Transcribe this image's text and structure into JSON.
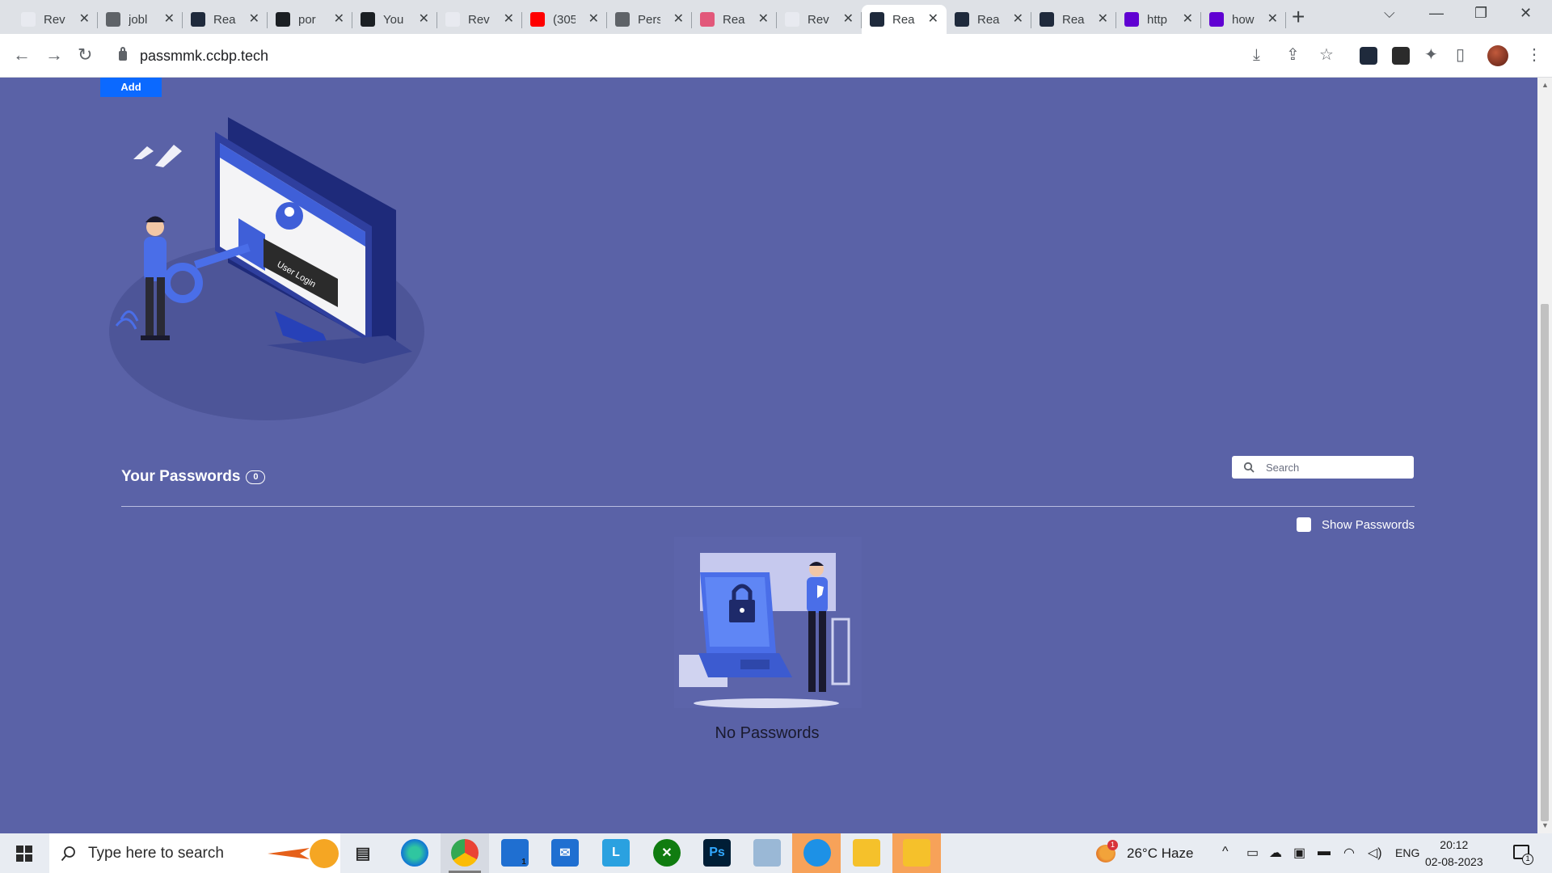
{
  "browser": {
    "tabs": [
      {
        "label": "Rev",
        "icon": "nxt-wave-icon",
        "color": "#e8eaf0"
      },
      {
        "label": "jobl",
        "icon": "globe-icon",
        "color": "#5f6368"
      },
      {
        "label": "Rea",
        "icon": "react-icon",
        "color": "#1f2a3c"
      },
      {
        "label": "por",
        "icon": "github-icon",
        "color": "#1b1f23"
      },
      {
        "label": "You",
        "icon": "github-icon",
        "color": "#1b1f23"
      },
      {
        "label": "Rev",
        "icon": "nxt-wave-icon",
        "color": "#e8eaf0"
      },
      {
        "label": "(305",
        "icon": "youtube-icon",
        "color": "#ff0000"
      },
      {
        "label": "Pers",
        "icon": "globe-icon",
        "color": "#5f6368"
      },
      {
        "label": "Rea",
        "icon": "react-pink-icon",
        "color": "#e2587a"
      },
      {
        "label": "Rev",
        "icon": "nxt-wave-icon",
        "color": "#e8eaf0"
      },
      {
        "label": "Rea",
        "icon": "react-icon",
        "color": "#1f2a3c",
        "active": true
      },
      {
        "label": "Rea",
        "icon": "react-icon",
        "color": "#1f2a3c"
      },
      {
        "label": "Rea",
        "icon": "react-icon",
        "color": "#1f2a3c"
      },
      {
        "label": "http",
        "icon": "yahoo-icon",
        "color": "#6001d2"
      },
      {
        "label": "how",
        "icon": "yahoo-icon",
        "color": "#6001d2"
      }
    ],
    "url": "passmmk.ccbp.tech"
  },
  "page": {
    "add_label": "Add",
    "passwords_title": "Your Passwords",
    "passwords_count": "0",
    "search_placeholder": "Search",
    "show_passwords_label": "Show Passwords",
    "empty_message": "No Passwords",
    "login_screen_text": "User Login",
    "colors": {
      "background": "#5a62a7",
      "accent": "#0b69ff"
    }
  },
  "taskbar": {
    "search_placeholder": "Type here to search",
    "weather": "26°C  Haze",
    "weather_badge": "1",
    "language": "ENG",
    "time": "20:12",
    "date": "02-08-2023",
    "mail_badge": "1",
    "notification_badge": "1"
  }
}
